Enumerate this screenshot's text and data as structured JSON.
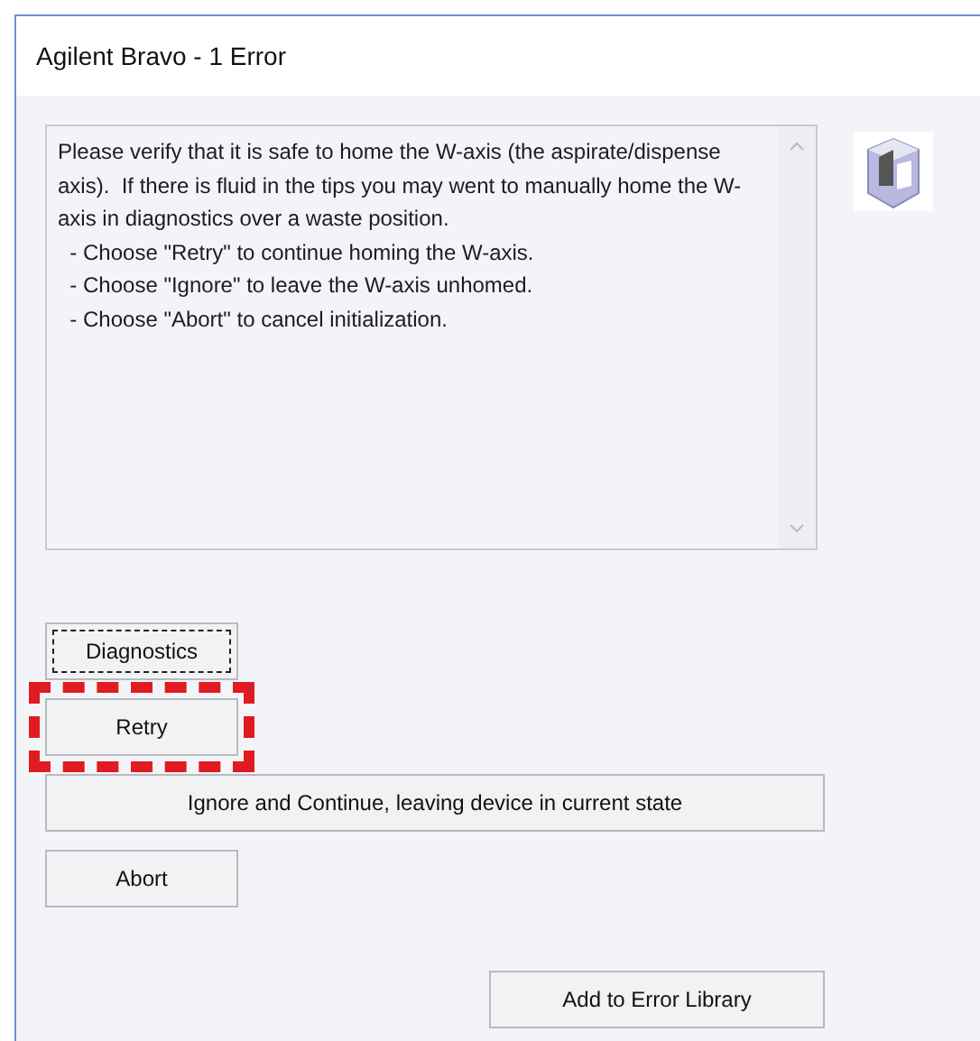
{
  "window": {
    "title": "Agilent Bravo - 1 Error"
  },
  "message": "Please verify that it is safe to home the W-axis (the aspirate/dispense axis).  If there is fluid in the tips you may went to manually home the W-axis in diagnostics over a waste position.\n  - Choose \"Retry\" to continue homing the W-axis.\n  - Choose \"Ignore\" to leave the W-axis unhomed.\n  - Choose \"Abort\" to cancel initialization.",
  "buttons": [
    {
      "label": "Diagnostics",
      "kind": "small",
      "focused": true,
      "highlighted": false
    },
    {
      "label": "Retry",
      "kind": "small",
      "focused": false,
      "highlighted": true
    },
    {
      "label": "Ignore and Continue, leaving device in current state",
      "kind": "wide",
      "focused": false,
      "highlighted": false
    },
    {
      "label": "Abort",
      "kind": "small",
      "focused": false,
      "highlighted": false
    }
  ],
  "footer_button": {
    "label": "Add to Error Library"
  }
}
